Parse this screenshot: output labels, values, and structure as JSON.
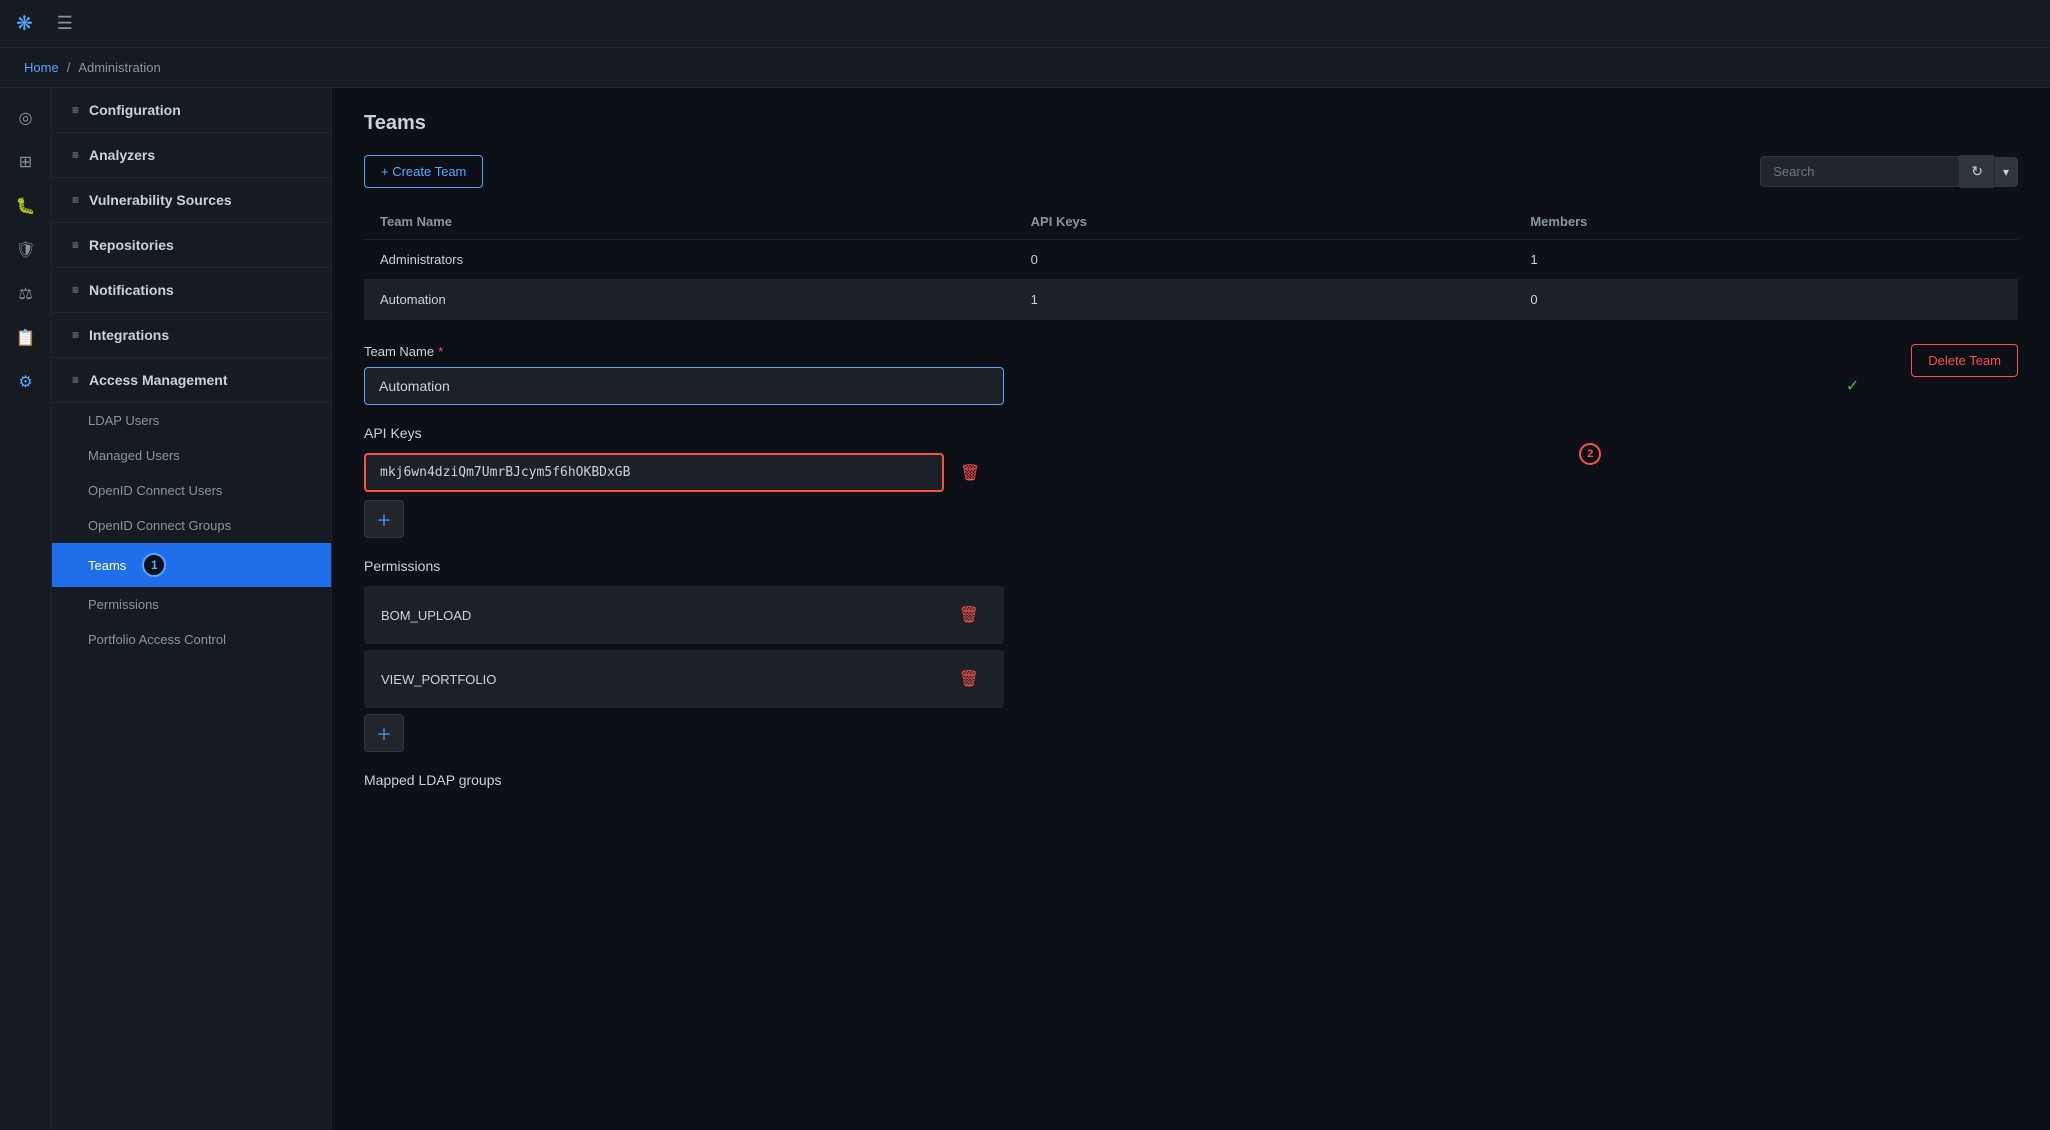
{
  "topbar": {
    "logo": "❋",
    "menu_icon": "☰"
  },
  "breadcrumb": {
    "home": "Home",
    "separator": "/",
    "current": "Administration"
  },
  "icon_rail": [
    {
      "name": "dashboard-icon",
      "icon": "◎"
    },
    {
      "name": "hierarchy-icon",
      "icon": "⊞"
    },
    {
      "name": "bug-icon",
      "icon": "⚙"
    },
    {
      "name": "shield-icon",
      "icon": "🛡"
    },
    {
      "name": "scale-icon",
      "icon": "⚖"
    },
    {
      "name": "document-icon",
      "icon": "📋"
    },
    {
      "name": "gear-icon",
      "icon": "⚙"
    }
  ],
  "sidebar": {
    "sections": [
      {
        "id": "configuration",
        "label": "Configuration"
      },
      {
        "id": "analyzers",
        "label": "Analyzers"
      },
      {
        "id": "vulnerability-sources",
        "label": "Vulnerability Sources"
      },
      {
        "id": "repositories",
        "label": "Repositories"
      },
      {
        "id": "notifications",
        "label": "Notifications"
      },
      {
        "id": "integrations",
        "label": "Integrations"
      },
      {
        "id": "access-management",
        "label": "Access Management"
      }
    ],
    "subitems": [
      {
        "id": "ldap-users",
        "label": "LDAP Users"
      },
      {
        "id": "managed-users",
        "label": "Managed Users"
      },
      {
        "id": "openid-connect-users",
        "label": "OpenID Connect Users"
      },
      {
        "id": "openid-connect-groups",
        "label": "OpenID Connect Groups"
      },
      {
        "id": "teams",
        "label": "Teams",
        "active": true
      },
      {
        "id": "permissions",
        "label": "Permissions"
      },
      {
        "id": "portfolio-access-control",
        "label": "Portfolio Access Control"
      }
    ]
  },
  "page": {
    "title": "Teams"
  },
  "toolbar": {
    "create_button": "+ Create Team",
    "search_placeholder": "Search",
    "refresh_icon": "↻",
    "dropdown_icon": "▾"
  },
  "table": {
    "columns": [
      "Team Name",
      "API Keys",
      "Members"
    ],
    "rows": [
      {
        "team_name": "Administrators",
        "api_keys": "0",
        "members": "1"
      },
      {
        "team_name": "Automation",
        "api_keys": "1",
        "members": "0"
      }
    ]
  },
  "form": {
    "team_name_label": "Team Name",
    "team_name_required": "*",
    "team_name_value": "Automation",
    "check_icon": "✓",
    "api_keys_label": "API Keys",
    "api_key_value": "mkj6wn4dziQm7UmrBJcym5f6hOKBDxGB",
    "api_key_badge": "2",
    "delete_icon": "🗑",
    "add_icon": "＋",
    "delete_team_label": "Delete Team",
    "permissions_label": "Permissions",
    "permissions": [
      {
        "name": "BOM_UPLOAD"
      },
      {
        "name": "VIEW_PORTFOLIO"
      }
    ],
    "mapped_ldap_label": "Mapped LDAP groups",
    "active_badge": "1"
  }
}
